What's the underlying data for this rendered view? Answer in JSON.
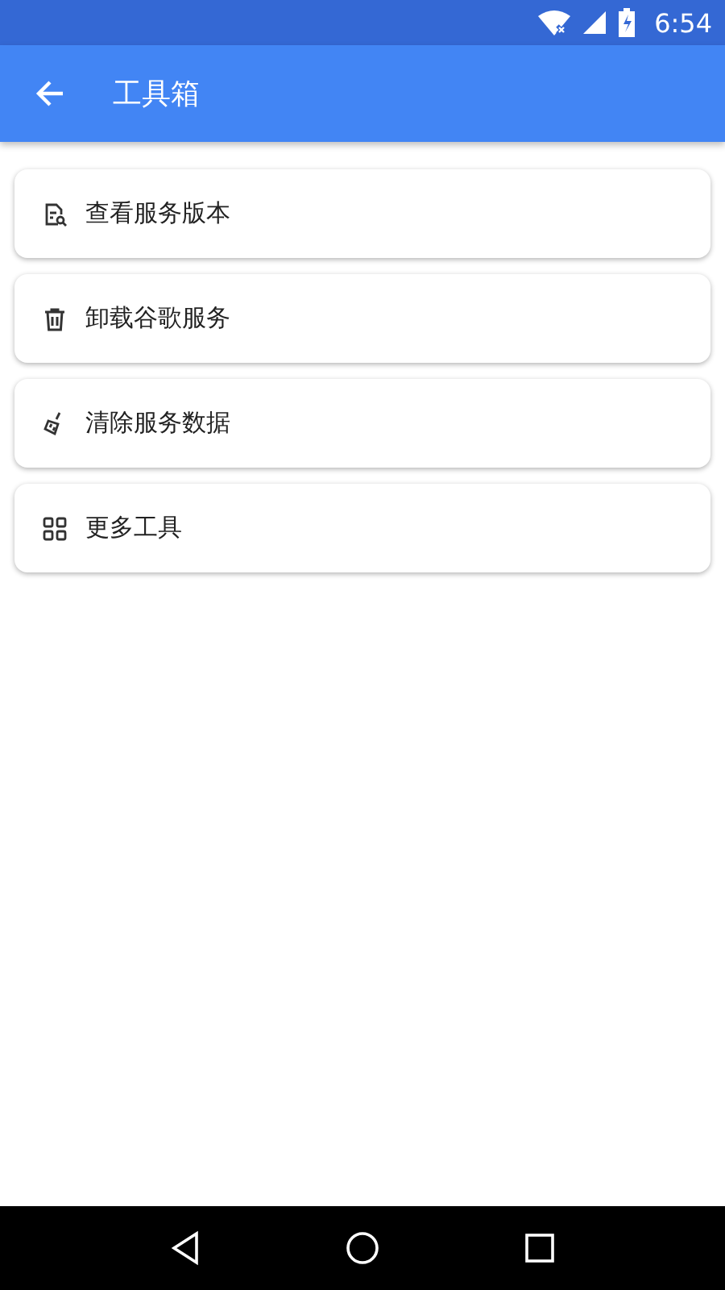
{
  "status_bar": {
    "time": "6:54"
  },
  "app_bar": {
    "title": "工具箱"
  },
  "items": [
    {
      "kind": "version",
      "label": "查看服务版本"
    },
    {
      "kind": "uninstall",
      "label": "卸载谷歌服务"
    },
    {
      "kind": "clean",
      "label": "清除服务数据"
    },
    {
      "kind": "more",
      "label": "更多工具"
    }
  ]
}
